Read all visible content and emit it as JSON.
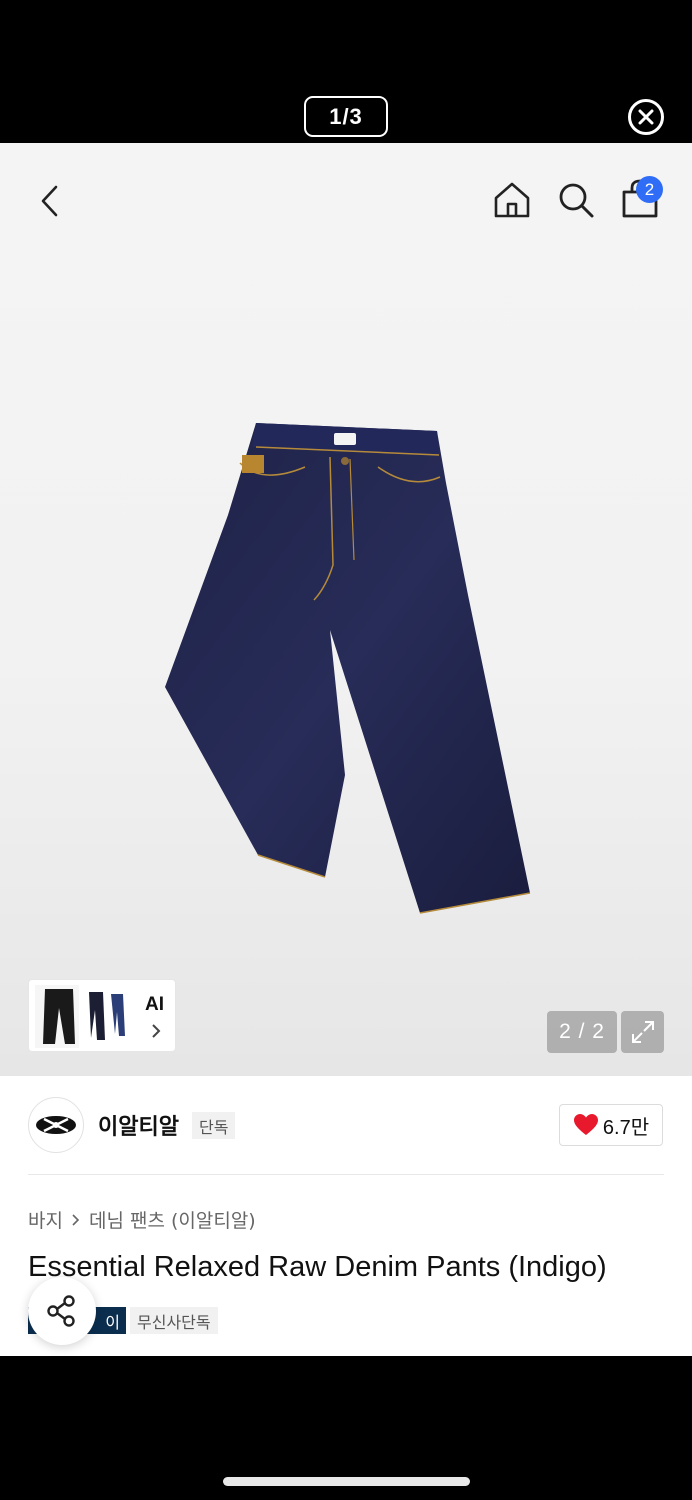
{
  "viewer": {
    "page_counter": "1/3",
    "close_icon": "close-circle-icon"
  },
  "nav": {
    "back_icon": "chevron-left-icon",
    "home_icon": "home-icon",
    "search_icon": "search-icon",
    "cart_icon": "shopping-bag-icon",
    "cart_count": "2",
    "badge_color": "#2f6df6"
  },
  "gallery": {
    "product_image": "indigo-raw-denim-pants-photo",
    "ai_label": "AI",
    "image_index": "2 / 2",
    "expand_icon": "expand-icon"
  },
  "brand": {
    "name": "이알티알",
    "tag": "단독",
    "like_count": "6.7만"
  },
  "breadcrumb": {
    "category": "바지",
    "subcategory": "데님 팬츠 (이알티알)"
  },
  "product": {
    "title": "Essential Relaxed Raw Denim Pants (Indigo)",
    "pay_badge": "이",
    "exclusive_badge": "무신사단독",
    "pay_badge_color": "#0b2e4f"
  },
  "share": {
    "icon": "share-icon"
  }
}
